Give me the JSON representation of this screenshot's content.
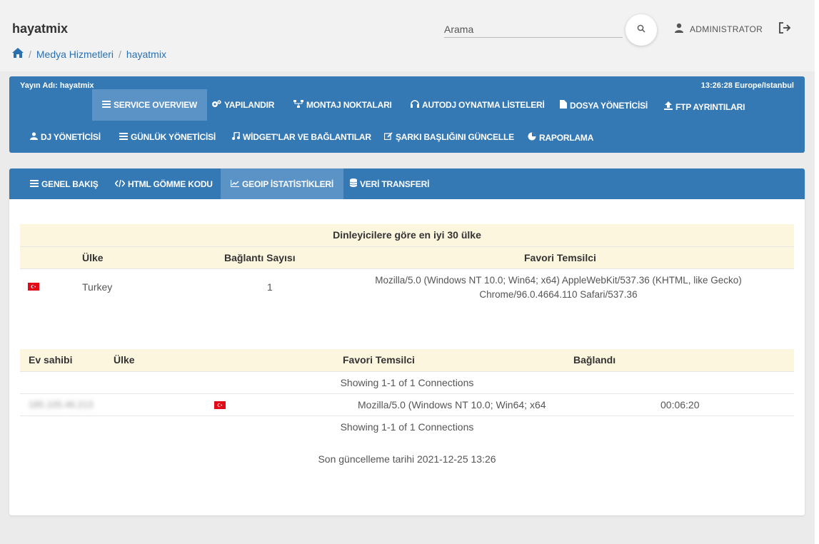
{
  "header": {
    "app_title": "hayatmix",
    "breadcrumb": [
      "Medya Hizmetleri",
      "hayatmix"
    ],
    "search_placeholder": "Arama",
    "user_label": "ADMINISTRATOR"
  },
  "stream_bar": {
    "stream_name": "Yayın Adı: hayatmix",
    "time": "13:26:28 Europe/Istanbul",
    "nav": [
      {
        "label": "SERVICE OVERVIEW",
        "icon": "list-icon"
      },
      {
        "label": "YAPILANDIR",
        "icon": "cogs-icon"
      },
      {
        "label": "MONTAJ NOKTALARI",
        "icon": "sitemap-icon"
      },
      {
        "label": "AUTODJ OYNATMA LİSTELERİ",
        "icon": "headphones-icon"
      },
      {
        "label": "DOSYA YÖNETİCİSİ",
        "icon": "file-icon"
      },
      {
        "label": "FTP AYRINTILARI",
        "icon": "upload-icon"
      },
      {
        "label": "DJ YÖNETİCİSİ",
        "icon": "user-icon"
      },
      {
        "label": "GÜNLÜK YÖNETİCİSİ",
        "icon": "list-icon"
      },
      {
        "label": "WİDGET'LAR VE BAĞLANTILAR",
        "icon": "music-icon"
      },
      {
        "label": "ŞARKI BAŞLIĞINI GÜNCELLE",
        "icon": "edit-icon"
      },
      {
        "label": "RAPORLAMA",
        "icon": "pie-chart-icon"
      }
    ]
  },
  "tabs": [
    {
      "label": "GENEL BAKIŞ",
      "icon": "list-icon"
    },
    {
      "label": "HTML GÖMME KODU",
      "icon": "code-icon"
    },
    {
      "label": "GEOIP İSTATİSTİKLERİ",
      "icon": "line-chart-icon"
    },
    {
      "label": "VERİ TRANSFERİ",
      "icon": "database-icon"
    }
  ],
  "countries_table": {
    "caption": "Dinleyicilere göre en iyi 30 ülke",
    "headers": [
      "Ülke",
      "Bağlantı Sayısı",
      "Favori Temsilci"
    ],
    "rows": [
      {
        "country": "Turkey",
        "connections": "1",
        "agent_line1": "Mozilla/5.0 (Windows NT 10.0; Win64; x64) AppleWebKit/537.36 (KHTML, like Gecko)",
        "agent_line2": "Chrome/96.0.4664.110 Safari/537.36"
      }
    ]
  },
  "connections_table": {
    "headers": [
      "Ev sahibi",
      "Ülke",
      "Favori Temsilci",
      "Bağlandı"
    ],
    "pagination_top": "Showing 1-1 of 1 Connections",
    "rows": [
      {
        "host": "185.105.46.213",
        "agent": "Mozilla/5.0 (Windows NT 10.0; Win64; x64",
        "connected": "00:06:20"
      }
    ],
    "pagination_bottom": "Showing 1-1 of 1 Connections"
  },
  "last_updated": "Son güncelleme tarihi 2021-12-25 13:26",
  "colors": {
    "primary": "#3478b4",
    "active": "#5b93c6",
    "header_bg": "#fdf6df",
    "flag_red": "#e30a17"
  }
}
